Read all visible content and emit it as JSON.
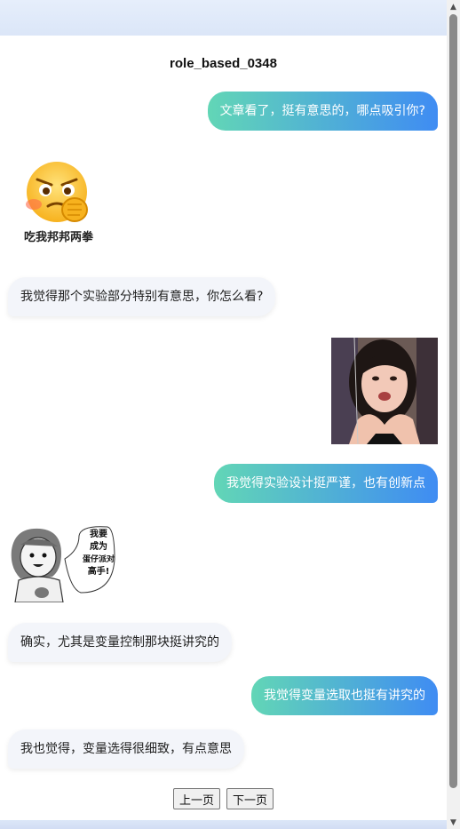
{
  "title": "role_based_0348",
  "messages": [
    {
      "side": "right",
      "text": "文章看了，挺有意思的，哪点吸引你?"
    },
    {
      "side": "left",
      "sticker": "angry-face-emoji",
      "caption": "吃我邦邦两拳"
    },
    {
      "side": "left",
      "text": "我觉得那个实验部分特别有意思，你怎么看?"
    },
    {
      "side": "right",
      "image": "girl-heart-hands-photo"
    },
    {
      "side": "right",
      "text": "我觉得实验设计挺严谨，也有创新点"
    },
    {
      "side": "left",
      "sticker": "comic-girl",
      "caption": "我要\n成为\n蛋仔派对\n高手!"
    },
    {
      "side": "left",
      "text": "确实，尤其是变量控制那块挺讲究的"
    },
    {
      "side": "right",
      "text": "我觉得变量选取也挺有讲究的"
    },
    {
      "side": "left",
      "text": "我也觉得，变量选得很细致，有点意思"
    }
  ],
  "comic_lines": [
    "我要",
    "成为",
    "蛋仔派对",
    "高手!"
  ],
  "pager": {
    "prev": "上一页",
    "next": "下一页"
  },
  "colors": {
    "bubble_right_start": "#62d6b6",
    "bubble_right_end": "#3f8cf3",
    "bubble_left": "#f3f5fa"
  }
}
